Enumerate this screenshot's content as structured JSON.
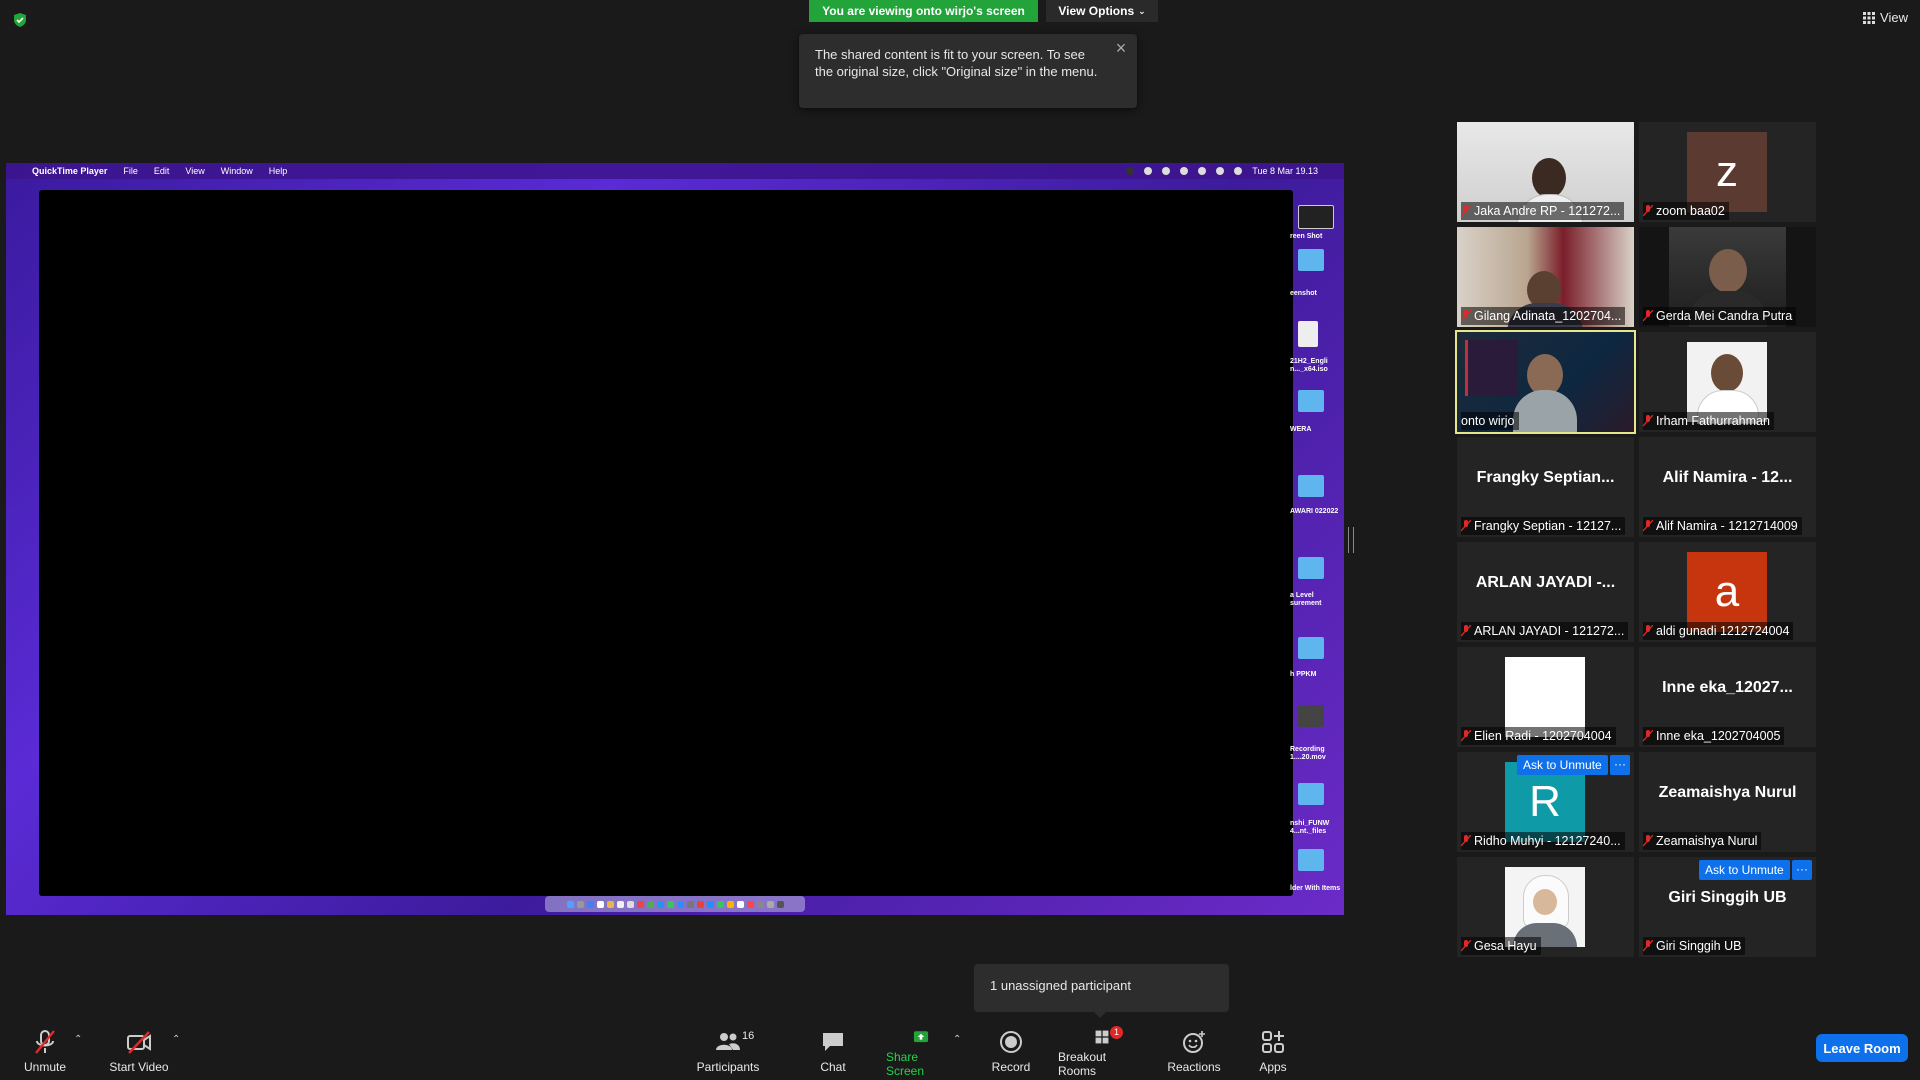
{
  "top": {
    "viewing_banner": "You are viewing onto wirjo's screen",
    "view_options": "View Options",
    "view_button": "View"
  },
  "tooltip": {
    "text": "The shared content is fit to your screen. To see the original size, click \"Original size\" in the menu."
  },
  "shared_screen": {
    "menubar": {
      "app": "QuickTime Player",
      "items": [
        "File",
        "Edit",
        "View",
        "Window",
        "Help"
      ],
      "clock": "Tue 8 Mar  19.13"
    },
    "desktop_labels": [
      "reen Shot",
      "eenshot",
      "21H2_Engli n..._x64.iso",
      "WERA",
      "AWARI 022022",
      "a Level surement",
      "h PPKM",
      "Recording 1....20.mov",
      "nshi_FUNW 4...nt._files",
      "lder With Items"
    ]
  },
  "participants": [
    {
      "name": "Jaka Andre RP - 121272...",
      "kind": "video"
    },
    {
      "name": "zoom baa02",
      "kind": "letter",
      "letter": "z",
      "color": "#5b3a32"
    },
    {
      "name": "Gilang Adinata_1202704...",
      "kind": "video"
    },
    {
      "name": "Gerda Mei Candra Putra",
      "kind": "video"
    },
    {
      "name": "onto wirjo",
      "kind": "video",
      "active": true
    },
    {
      "name": "Irham Fathurrahman",
      "kind": "photo"
    },
    {
      "name": "Frangky Septian - 12127...",
      "kind": "text",
      "big": "Frangky  Septian..."
    },
    {
      "name": "Alif Namira - 1212714009",
      "kind": "text",
      "big": "Alif Namira - 12..."
    },
    {
      "name": "ARLAN JAYADI - 121272...",
      "kind": "text",
      "big": "ARLAN JAYADI -..."
    },
    {
      "name": "aldi gunadi 1212724004",
      "kind": "letter",
      "letter": "a",
      "color": "#c7350f"
    },
    {
      "name": "Elien Radi - 1202704004",
      "kind": "white"
    },
    {
      "name": "Inne eka_1202704005",
      "kind": "text",
      "big": "Inne eka_12027..."
    },
    {
      "name": "Ridho Muhyi - 12127240...",
      "kind": "letter",
      "letter": "R",
      "color": "#0e9aa7",
      "ask": true
    },
    {
      "name": "Zeamaishya Nurul",
      "kind": "text",
      "big": "Zeamaishya Nurul"
    },
    {
      "name": "Gesa Hayu",
      "kind": "photo2"
    },
    {
      "name": "Giri Singgih UB",
      "kind": "text",
      "big": "Giri Singgih UB",
      "ask": true
    }
  ],
  "ask_to_unmute": "Ask to Unmute",
  "more": "···",
  "unassigned": "1 unassigned participant",
  "toolbar": {
    "unmute": "Unmute",
    "start_video": "Start Video",
    "participants": "Participants",
    "participants_count": "16",
    "chat": "Chat",
    "share_screen": "Share Screen",
    "record": "Record",
    "breakout_rooms": "Breakout Rooms",
    "breakout_badge": "1",
    "reactions": "Reactions",
    "apps": "Apps",
    "leave_room": "Leave Room"
  },
  "colors": {
    "share_green": "#23a43a",
    "accent_blue": "#0e71eb",
    "active_outline": "#e6e68a",
    "mute_red": "#e02828"
  }
}
